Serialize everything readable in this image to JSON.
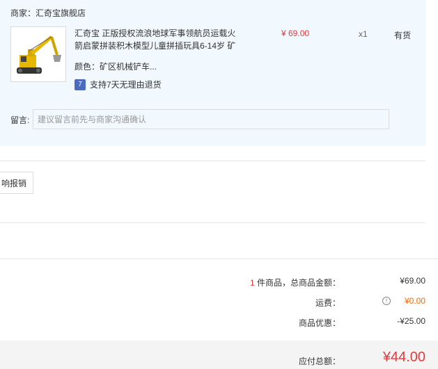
{
  "shop": {
    "name": "商家：汇奇宝旗舰店"
  },
  "product": {
    "title": "汇奇宝 正版授权流浪地球军事领航员运载火箭启蒙拼装积木模型儿童拼插玩具6-14岁 矿",
    "price": "¥ 69.00",
    "quantity": "x1",
    "stock": "有货",
    "variant": "颜色：矿区机械铲车...",
    "return_policy": "支持7天无理由退货",
    "return_badge": "7"
  },
  "message": {
    "label": "留言:",
    "placeholder": "建议留言前先与商家沟通确认"
  },
  "invoice": {
    "label": "响报销"
  },
  "summary": {
    "count": "1",
    "goods_label": " 件商品，总商品金额：",
    "goods_value": "¥69.00",
    "shipping_label": "运费：",
    "shipping_value": "¥0.00",
    "discount_label": "商品优惠：",
    "discount_value": "-¥25.00",
    "total_label": "应付总额：",
    "total_value": "¥44.00"
  },
  "colors": {
    "accent": "#e4393c",
    "panel_bg": "#f1f8fe"
  }
}
